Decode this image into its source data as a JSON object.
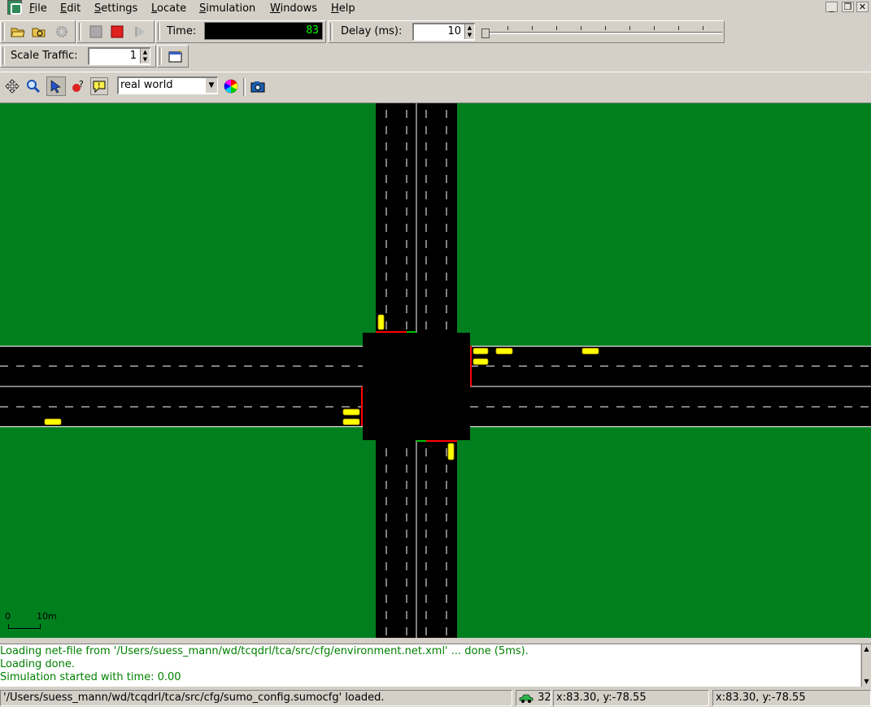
{
  "menu": {
    "items": [
      {
        "label": "File",
        "mnemonic": "F"
      },
      {
        "label": "Edit",
        "mnemonic": "E"
      },
      {
        "label": "Settings",
        "mnemonic": "S"
      },
      {
        "label": "Locate",
        "mnemonic": "L"
      },
      {
        "label": "Simulation",
        "mnemonic": "S"
      },
      {
        "label": "Windows",
        "mnemonic": "W"
      },
      {
        "label": "Help",
        "mnemonic": "H"
      }
    ]
  },
  "toolbar": {
    "time_label": "Time:",
    "time_value": "83",
    "delay_label": "Delay (ms):",
    "delay_value": "10",
    "delay_fraction": 0.0,
    "scale_label": "Scale Traffic:",
    "scale_value": "1"
  },
  "view": {
    "scheme_selected": "real world"
  },
  "canvas": {
    "scale_start": "0",
    "scale_end": "10m"
  },
  "messages": [
    "Loading net-file from '/Users/suess_mann/wd/tcqdrl/tca/src/cfg/environment.net.xml' ... done (5ms).",
    "Loading done.",
    "Simulation started with time: 0.00"
  ],
  "status": {
    "loaded_text": "'/Users/suess_mann/wd/tcqdrl/tca/src/cfg/sumo_config.sumocfg' loaded.",
    "vehicle_count": "32",
    "coords_1": "x:83.30, y:-78.55",
    "coords_2": "x:83.30, y:-78.55"
  },
  "colors": {
    "grass": "#007f1f",
    "road": "#000000",
    "vehicle": "#ffff00",
    "signal_red": "#ff0000",
    "signal_green": "#00c000",
    "message_text": "#008000"
  }
}
